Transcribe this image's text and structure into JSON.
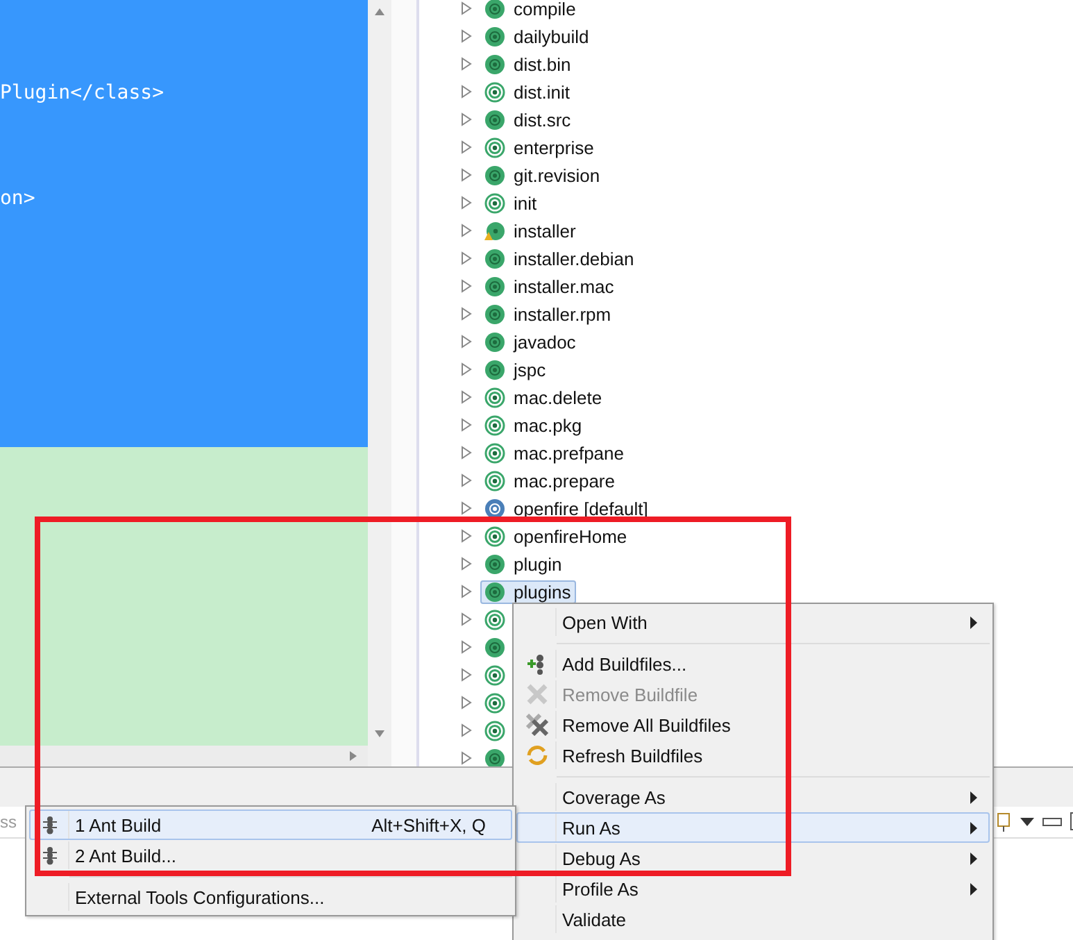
{
  "editor": {
    "lines": [
      "Plugin</class>",
      "on>"
    ]
  },
  "tree": {
    "items": [
      {
        "label": "compile",
        "kind": "solid",
        "selected": false
      },
      {
        "label": "dailybuild",
        "kind": "solid",
        "selected": false
      },
      {
        "label": "dist.bin",
        "kind": "solid",
        "selected": false
      },
      {
        "label": "dist.init",
        "kind": "ring",
        "selected": false
      },
      {
        "label": "dist.src",
        "kind": "solid",
        "selected": false
      },
      {
        "label": "enterprise",
        "kind": "ring",
        "selected": false
      },
      {
        "label": "git.revision",
        "kind": "solid",
        "selected": false
      },
      {
        "label": "init",
        "kind": "ring",
        "selected": false
      },
      {
        "label": "installer",
        "kind": "warning",
        "selected": false
      },
      {
        "label": "installer.debian",
        "kind": "solid",
        "selected": false
      },
      {
        "label": "installer.mac",
        "kind": "solid",
        "selected": false
      },
      {
        "label": "installer.rpm",
        "kind": "solid",
        "selected": false
      },
      {
        "label": "javadoc",
        "kind": "solid",
        "selected": false
      },
      {
        "label": "jspc",
        "kind": "solid",
        "selected": false
      },
      {
        "label": "mac.delete",
        "kind": "ring",
        "selected": false
      },
      {
        "label": "mac.pkg",
        "kind": "ring",
        "selected": false
      },
      {
        "label": "mac.prefpane",
        "kind": "ring",
        "selected": false
      },
      {
        "label": "mac.prepare",
        "kind": "ring",
        "selected": false
      },
      {
        "label": "openfire [default]",
        "kind": "default",
        "selected": false
      },
      {
        "label": "openfireHome",
        "kind": "ring",
        "selected": false
      },
      {
        "label": "plugin",
        "kind": "solid",
        "selected": false
      },
      {
        "label": "plugins",
        "kind": "solid",
        "selected": true
      },
      {
        "kind": "ring",
        "selected": false
      },
      {
        "kind": "solid",
        "selected": false
      },
      {
        "kind": "ring",
        "selected": false
      },
      {
        "kind": "ring",
        "selected": false
      },
      {
        "kind": "ring",
        "selected": false
      },
      {
        "kind": "solid",
        "selected": false
      }
    ]
  },
  "toolbar": {
    "label": "ss"
  },
  "context_menu": {
    "items": [
      {
        "kind": "plain",
        "label": "Open With",
        "submenu": true,
        "disabled": false,
        "selected": false
      },
      {
        "kind": "separator"
      },
      {
        "kind": "add",
        "label": "Add Buildfiles...",
        "submenu": false,
        "disabled": false,
        "selected": false
      },
      {
        "kind": "remove",
        "label": "Remove Buildfile",
        "submenu": false,
        "disabled": true,
        "selected": false
      },
      {
        "kind": "remove_all",
        "label": "Remove All Buildfiles",
        "submenu": false,
        "disabled": false,
        "selected": false
      },
      {
        "kind": "refresh",
        "label": "Refresh Buildfiles",
        "submenu": false,
        "disabled": false,
        "selected": false
      },
      {
        "kind": "separator"
      },
      {
        "kind": "plain",
        "label": "Coverage As",
        "submenu": true,
        "disabled": false,
        "selected": false
      },
      {
        "kind": "plain",
        "label": "Run As",
        "submenu": true,
        "disabled": false,
        "selected": true
      },
      {
        "kind": "plain",
        "label": "Debug As",
        "submenu": true,
        "disabled": false,
        "selected": false
      },
      {
        "kind": "plain",
        "label": "Profile As",
        "submenu": true,
        "disabled": false,
        "selected": false
      },
      {
        "kind": "plain",
        "label": "Validate",
        "submenu": false,
        "disabled": false,
        "selected": false
      }
    ]
  },
  "run_as_menu": {
    "items": [
      {
        "kind": "ant",
        "label": "1 Ant Build",
        "shortcut": "Alt+Shift+X, Q",
        "selected": true
      },
      {
        "kind": "ant",
        "label": "2 Ant Build...",
        "selected": false
      },
      {
        "kind": "separator"
      },
      {
        "kind": "plain",
        "label": "External Tools Configurations...",
        "selected": false
      }
    ]
  }
}
